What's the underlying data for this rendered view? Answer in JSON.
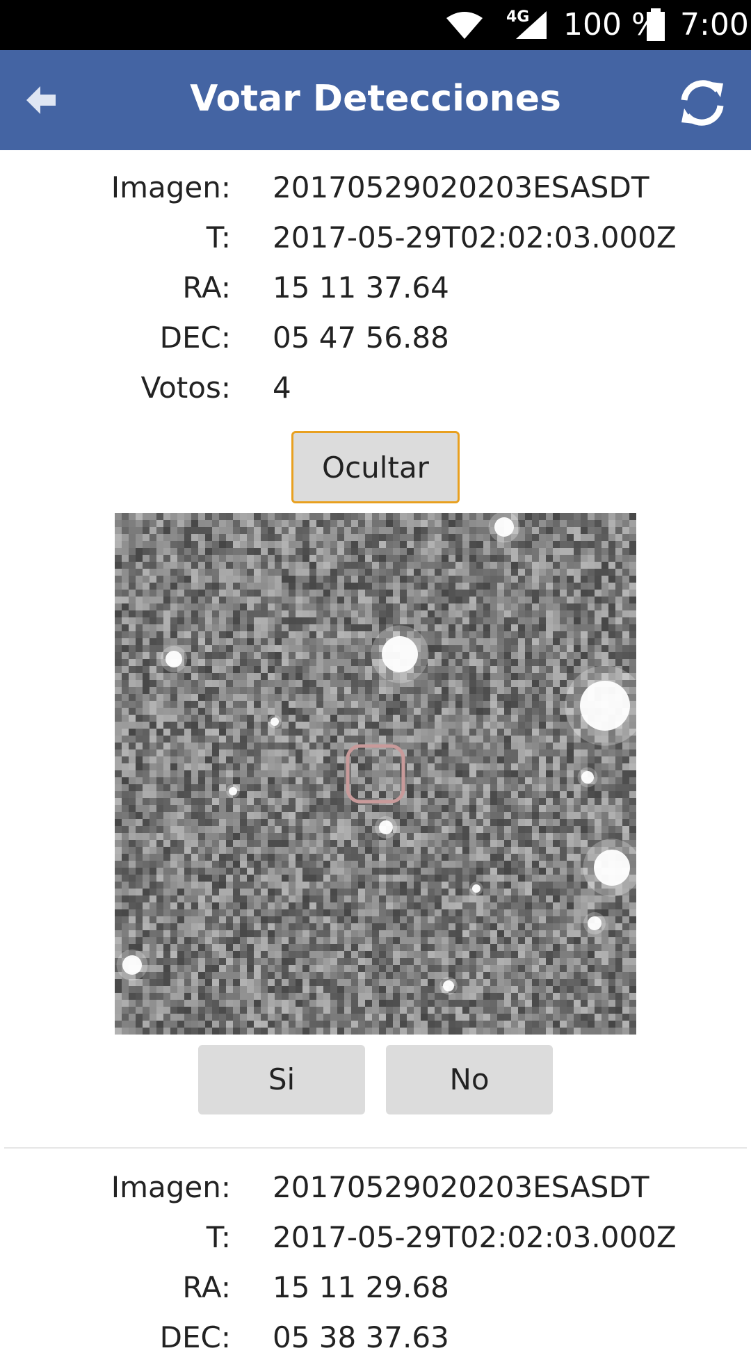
{
  "status_bar": {
    "network": "4G",
    "battery": "100 %",
    "time": "7:00"
  },
  "app_bar": {
    "title": "Votar Detecciones",
    "back_icon": "arrow-left-icon",
    "refresh_icon": "refresh-icon"
  },
  "detections": [
    {
      "fields": [
        {
          "label": "Imagen:",
          "value": "20170529020203ESASDT"
        },
        {
          "label": "T:",
          "value": "2017-05-29T02:02:03.000Z"
        },
        {
          "label": "RA:",
          "value": "15 11 37.64"
        },
        {
          "label": "DEC:",
          "value": "05 47 56.88"
        },
        {
          "label": "Votos:",
          "value": "4"
        }
      ],
      "hide_label": "Ocultar",
      "yes_label": "Si",
      "no_label": "No",
      "marker_color": "#c89a9a"
    },
    {
      "fields": [
        {
          "label": "Imagen:",
          "value": "20170529020203ESASDT"
        },
        {
          "label": "T:",
          "value": "2017-05-29T02:02:03.000Z"
        },
        {
          "label": "RA:",
          "value": "15 11 29.68"
        },
        {
          "label": "DEC:",
          "value": "05 38 37.63"
        }
      ]
    }
  ],
  "colors": {
    "app_bar": "#4464a3",
    "hide_button_border": "#e8a020",
    "button": "#dcdcdc"
  }
}
